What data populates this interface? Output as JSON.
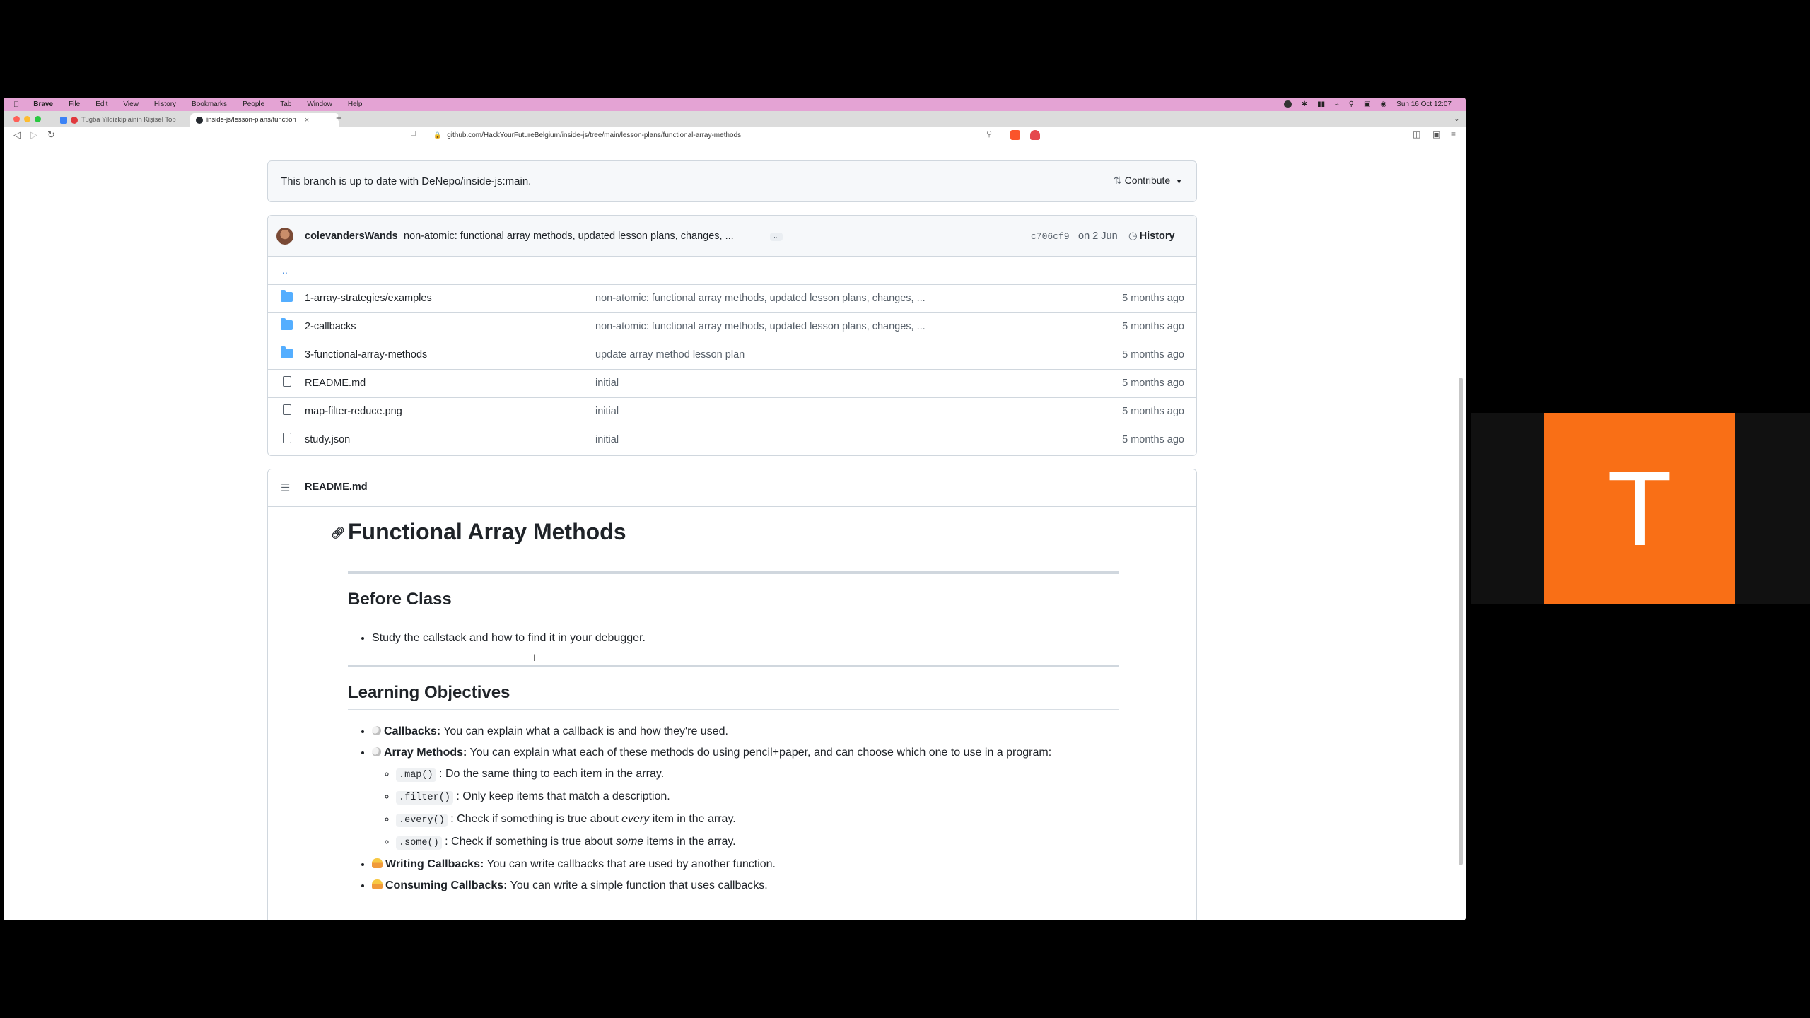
{
  "menubar": {
    "items": [
      "Brave",
      "File",
      "Edit",
      "View",
      "History",
      "Bookmarks",
      "People",
      "Tab",
      "Window",
      "Help"
    ],
    "clock": "Sun 16 Oct  12:07"
  },
  "tabs": [
    {
      "title": "Tugba Yildizkiplainin Kişisel Top"
    },
    {
      "title": "inside-js/lesson-plans/function"
    }
  ],
  "address": {
    "url": "github.com/HackYourFutureBelgium/inside-js/tree/main/lesson-plans/functional-array-methods"
  },
  "branch": {
    "status": "This branch is up to date with DeNepo/inside-js:main.",
    "contribute_label": "Contribute"
  },
  "commit": {
    "author": "colevandersWands",
    "message": "non-atomic: functional array methods, updated lesson plans, changes, ...",
    "ellipsis": "...",
    "sha": "c706cf9",
    "date": "on 2 Jun",
    "history_label": "History"
  },
  "parent_dir": "..",
  "files": [
    {
      "type": "folder",
      "name": "1-array-strategies/examples",
      "message": "non-atomic: functional array methods, updated lesson plans, changes, ...",
      "age": "5 months ago"
    },
    {
      "type": "folder",
      "name": "2-callbacks",
      "message": "non-atomic: functional array methods, updated lesson plans, changes, ...",
      "age": "5 months ago"
    },
    {
      "type": "folder",
      "name": "3-functional-array-methods",
      "message": "update array method lesson plan",
      "age": "5 months ago"
    },
    {
      "type": "file",
      "name": "README.md",
      "message": "initial",
      "age": "5 months ago"
    },
    {
      "type": "file",
      "name": "map-filter-reduce.png",
      "message": "initial",
      "age": "5 months ago"
    },
    {
      "type": "file",
      "name": "study.json",
      "message": "initial",
      "age": "5 months ago"
    }
  ],
  "readme": {
    "filename": "README.md",
    "h1": "Functional Array Methods",
    "before_class": {
      "heading": "Before Class",
      "items": [
        "Study the callstack and how to find it in your debugger."
      ]
    },
    "objectives": {
      "heading": "Learning Objectives",
      "callbacks_label": "Callbacks:",
      "callbacks_text": " You can explain what a callback is and how they're used.",
      "array_methods_label": "Array Methods:",
      "array_methods_text": " You can explain what each of these methods do using pencil+paper, and can choose which one to use in a program:",
      "methods": [
        {
          "code": ".map()",
          "text": " : Do the same thing to each item in the array."
        },
        {
          "code": ".filter()",
          "text": " : Only keep items that match a description."
        },
        {
          "code": ".every()",
          "text_before": " : Check if something is true about ",
          "em": "every",
          "text_after": " item in the array."
        },
        {
          "code": ".some()",
          "text_before": " : Check if something is true about ",
          "em": "some",
          "text_after": " items in the array."
        }
      ],
      "writing_label": "Writing Callbacks:",
      "writing_text": " You can write callbacks that are used by another function.",
      "consuming_label": "Consuming Callbacks:",
      "consuming_text": " You can write a simple function that uses callbacks."
    }
  },
  "participant": {
    "initial": "T"
  },
  "colors": {
    "menubar": "#e4a3d4",
    "link": "#0969da",
    "folder": "#54aeff",
    "participant_tile": "#f96f16"
  }
}
